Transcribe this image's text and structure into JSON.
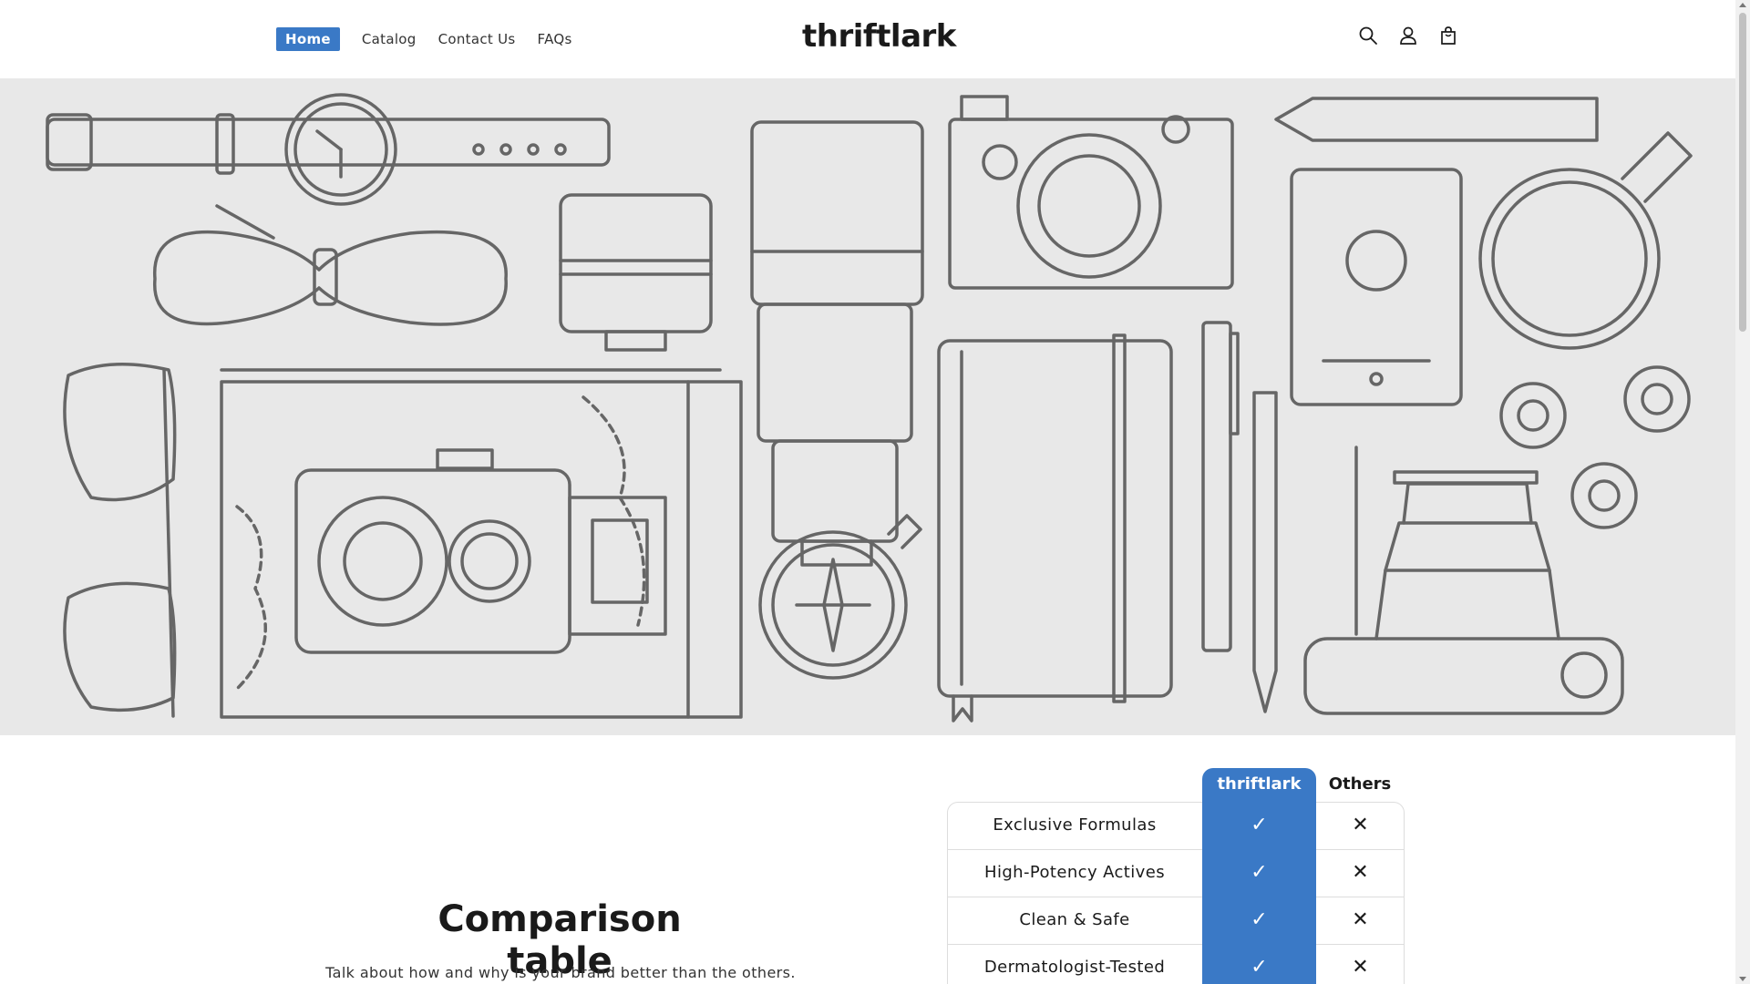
{
  "header": {
    "nav": [
      {
        "label": "Home",
        "active": true
      },
      {
        "label": "Catalog",
        "active": false
      },
      {
        "label": "Contact Us",
        "active": false
      },
      {
        "label": "FAQs",
        "active": false
      }
    ],
    "logo": "thriftlark",
    "icons": [
      "search-icon",
      "account-icon",
      "cart-icon"
    ]
  },
  "hero": {
    "background": "#e8e8e8",
    "illustration_items": [
      "wristwatch",
      "bow-tie",
      "camera-lens",
      "zoom-lens",
      "film-camera",
      "pen",
      "passport",
      "magnifying-glass",
      "sunglasses",
      "map",
      "twin-lens-camera",
      "compass",
      "notebook",
      "fountain-pen",
      "pencil",
      "film-rolls",
      "vintage-camera"
    ]
  },
  "comparison": {
    "title": "Comparison table",
    "subtitle": "Talk about how and why is your brand better than the others.",
    "brand_header": "thriftlark",
    "others_header": "Others",
    "accent": "#3a79c6",
    "rows": [
      {
        "label": "Exclusive Formulas",
        "brand": "✓",
        "others": "✕"
      },
      {
        "label": "High-Potency Actives",
        "brand": "✓",
        "others": "✕"
      },
      {
        "label": "Clean & Safe",
        "brand": "✓",
        "others": "✕"
      },
      {
        "label": "Dermatologist-Tested",
        "brand": "✓",
        "others": "✕"
      }
    ]
  }
}
